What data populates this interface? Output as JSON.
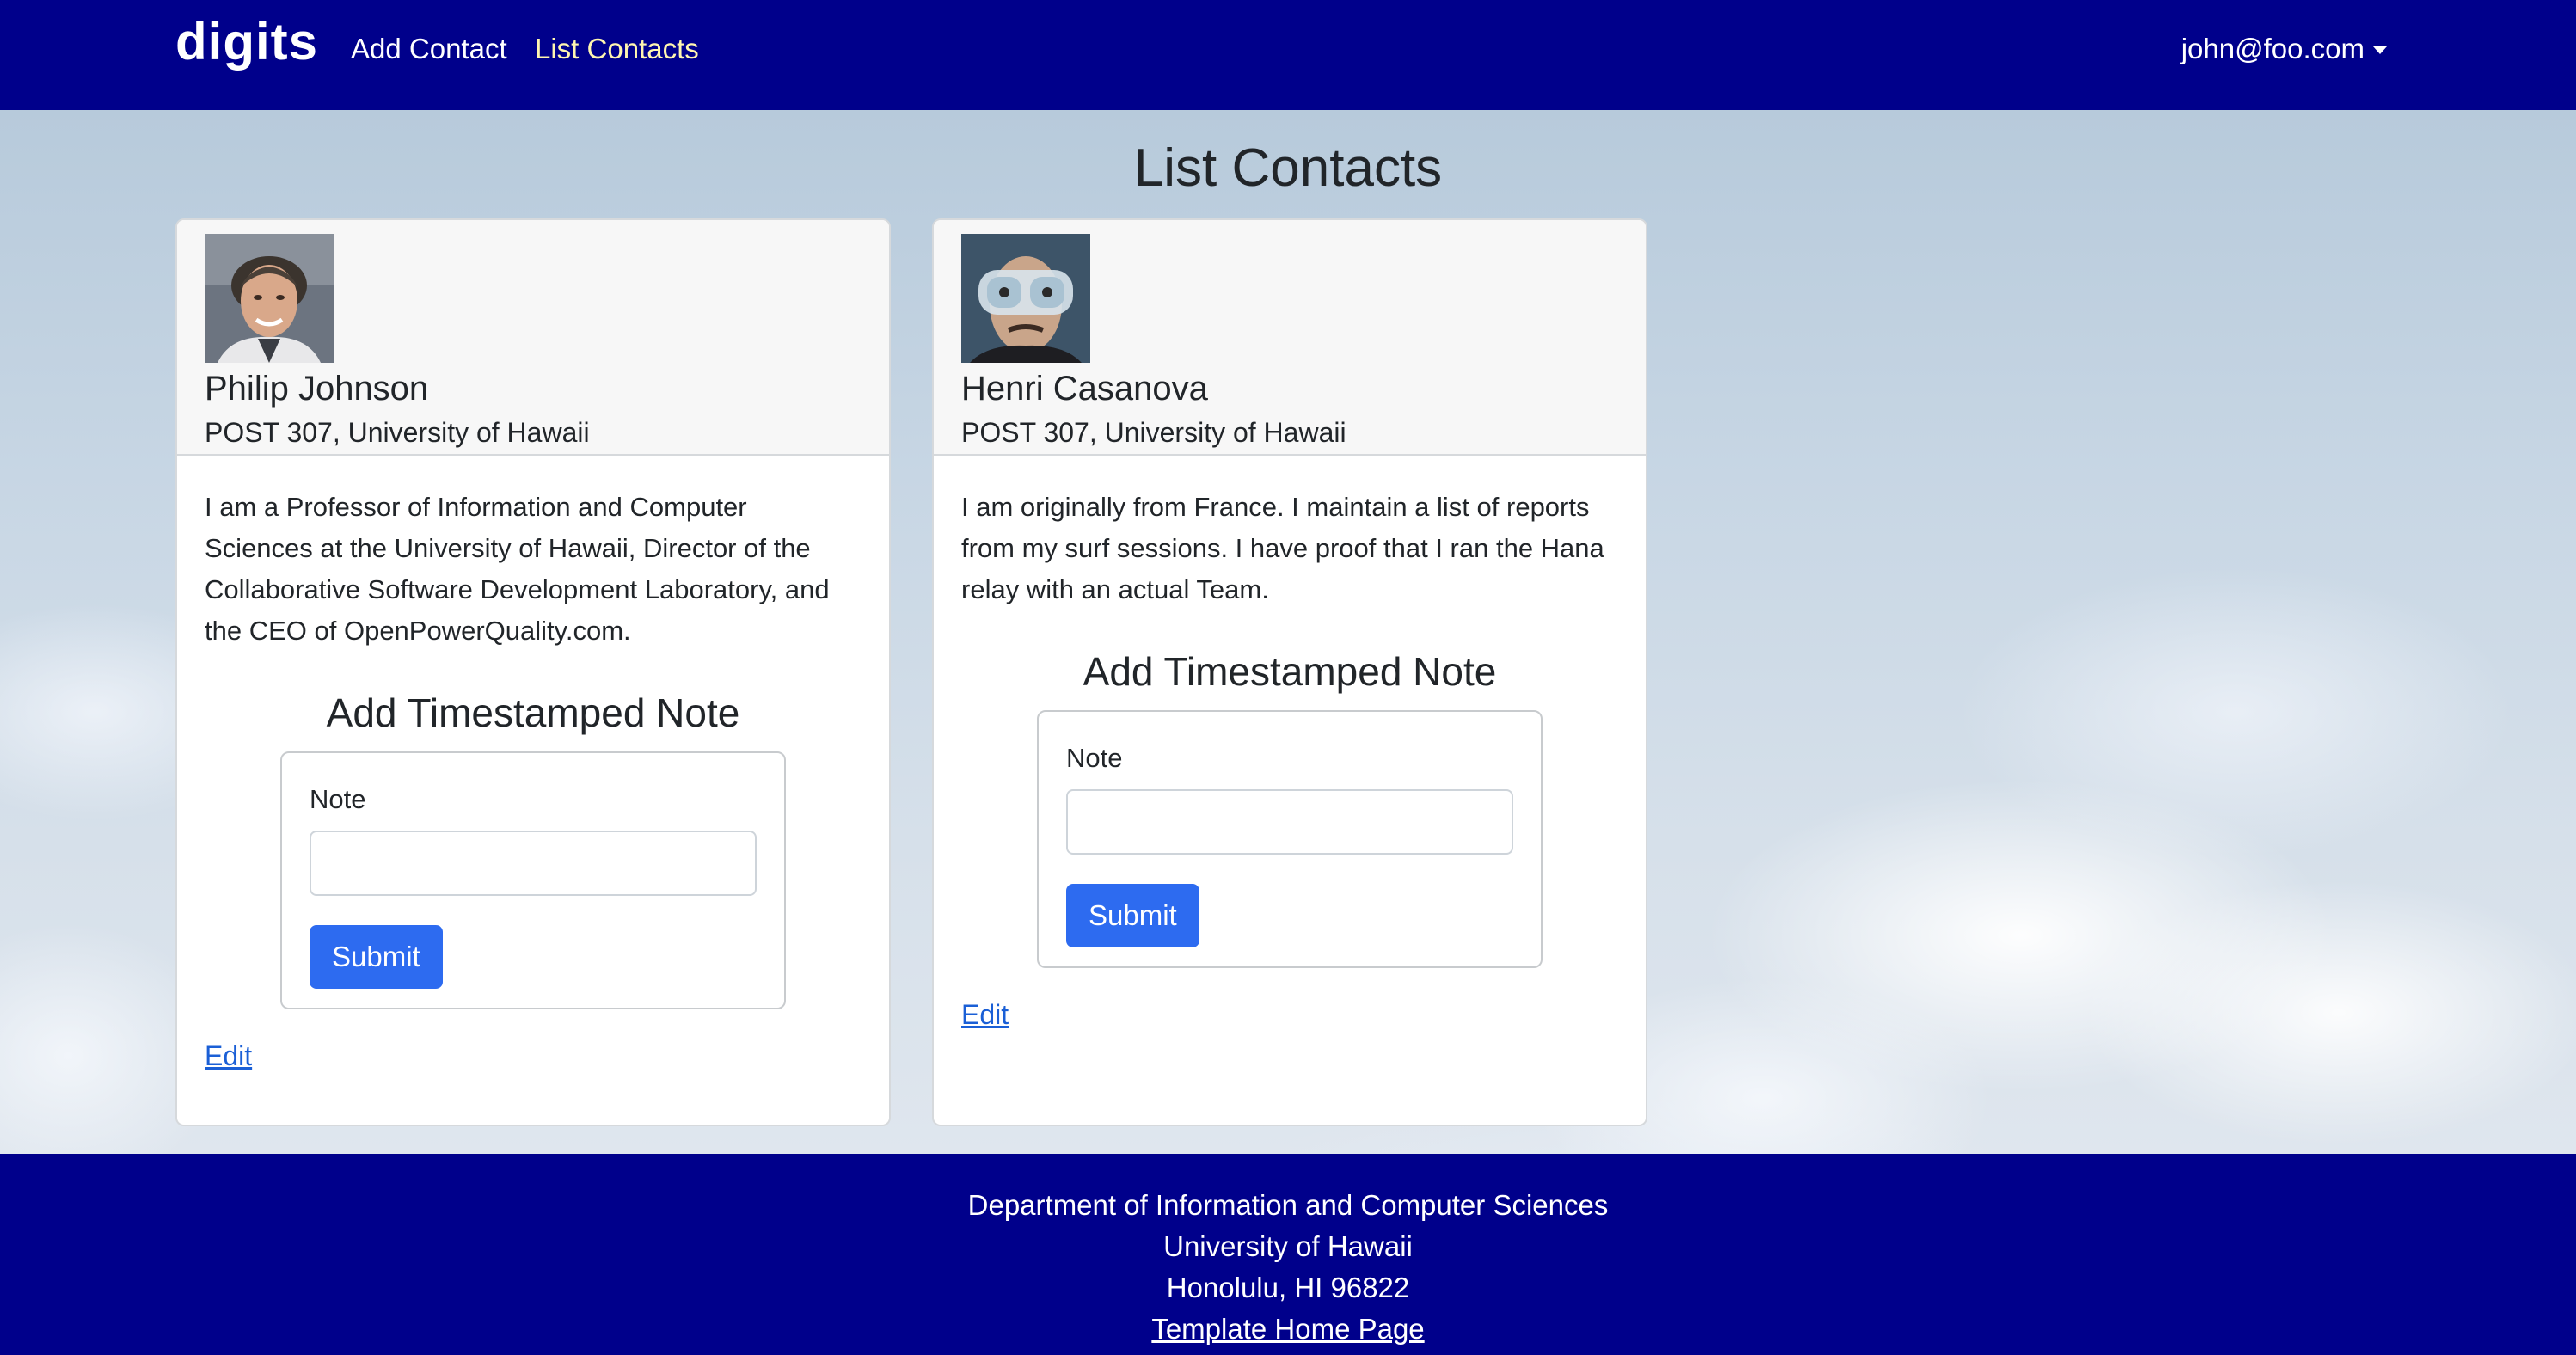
{
  "navbar": {
    "brand": "digits",
    "links": [
      {
        "label": "Add Contact",
        "active": false
      },
      {
        "label": "List Contacts",
        "active": true
      }
    ],
    "user": "john@foo.com"
  },
  "page": {
    "title": "List Contacts"
  },
  "contacts": [
    {
      "name": "Philip Johnson",
      "address": "POST 307, University of Hawaii",
      "description": "I am a Professor of Information and Computer Sciences at the University of Hawaii, Director of the Collaborative Software Development Laboratory, and the CEO of OpenPowerQuality.com.",
      "note_title": "Add Timestamped Note",
      "note_label": "Note",
      "note_value": "",
      "submit_label": "Submit",
      "edit_label": "Edit"
    },
    {
      "name": "Henri Casanova",
      "address": "POST 307, University of Hawaii",
      "description": "I am originally from France. I maintain a list of reports from my surf sessions. I have proof that I ran the Hana relay with an actual Team.",
      "note_title": "Add Timestamped Note",
      "note_label": "Note",
      "note_value": "",
      "submit_label": "Submit",
      "edit_label": "Edit"
    }
  ],
  "footer": {
    "line1": "Department of Information and Computer Sciences",
    "line2": "University of Hawaii",
    "line3": "Honolulu, HI 96822",
    "link": "Template Home Page"
  },
  "colors": {
    "navbar": "#00008b",
    "active_link": "#fff6b0",
    "primary_button": "#2d6bf0",
    "link": "#1a5fd6"
  }
}
